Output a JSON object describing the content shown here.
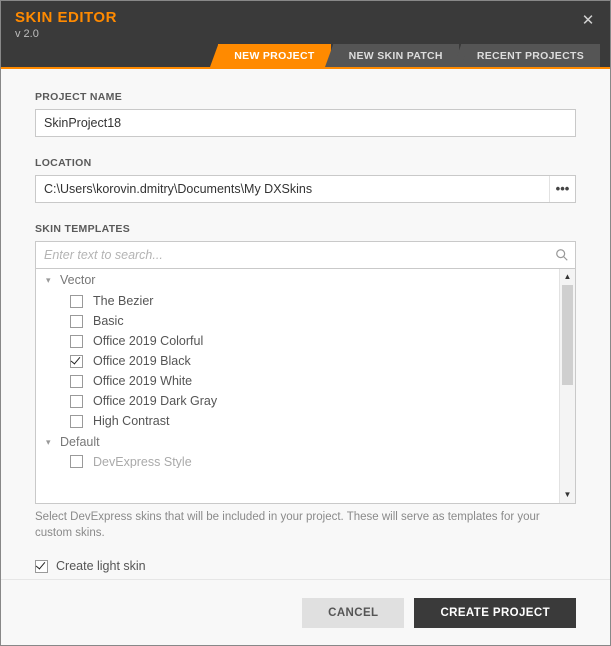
{
  "header": {
    "title": "SKIN EDITOR",
    "version": "v 2.0"
  },
  "tabs": {
    "new_project": "NEW PROJECT",
    "new_skin_patch": "NEW SKIN PATCH",
    "recent_projects": "RECENT PROJECTS"
  },
  "form": {
    "project_name_label": "PROJECT NAME",
    "project_name_value": "SkinProject18",
    "location_label": "LOCATION",
    "location_value": "C:\\Users\\korovin.dmitry\\Documents\\My DXSkins",
    "skin_templates_label": "SKIN TEMPLATES",
    "search_placeholder": "Enter text to search...",
    "help_text": "Select DevExpress skins that will be included in your project. These will serve as templates for your custom skins.",
    "create_light_skin_label": "Create light skin"
  },
  "tree": {
    "groups": [
      {
        "name": "Vector",
        "expanded": true,
        "items": [
          {
            "label": "The Bezier",
            "checked": false
          },
          {
            "label": "Basic",
            "checked": false
          },
          {
            "label": "Office 2019 Colorful",
            "checked": false
          },
          {
            "label": "Office 2019 Black",
            "checked": true
          },
          {
            "label": "Office 2019 White",
            "checked": false
          },
          {
            "label": "Office 2019 Dark Gray",
            "checked": false
          },
          {
            "label": "High Contrast",
            "checked": false
          }
        ]
      },
      {
        "name": "Default",
        "expanded": true,
        "items": [
          {
            "label": "DevExpress Style",
            "checked": false
          }
        ]
      }
    ]
  },
  "checkboxes": {
    "create_light_skin": true
  },
  "footer": {
    "cancel": "CANCEL",
    "create": "CREATE PROJECT"
  }
}
